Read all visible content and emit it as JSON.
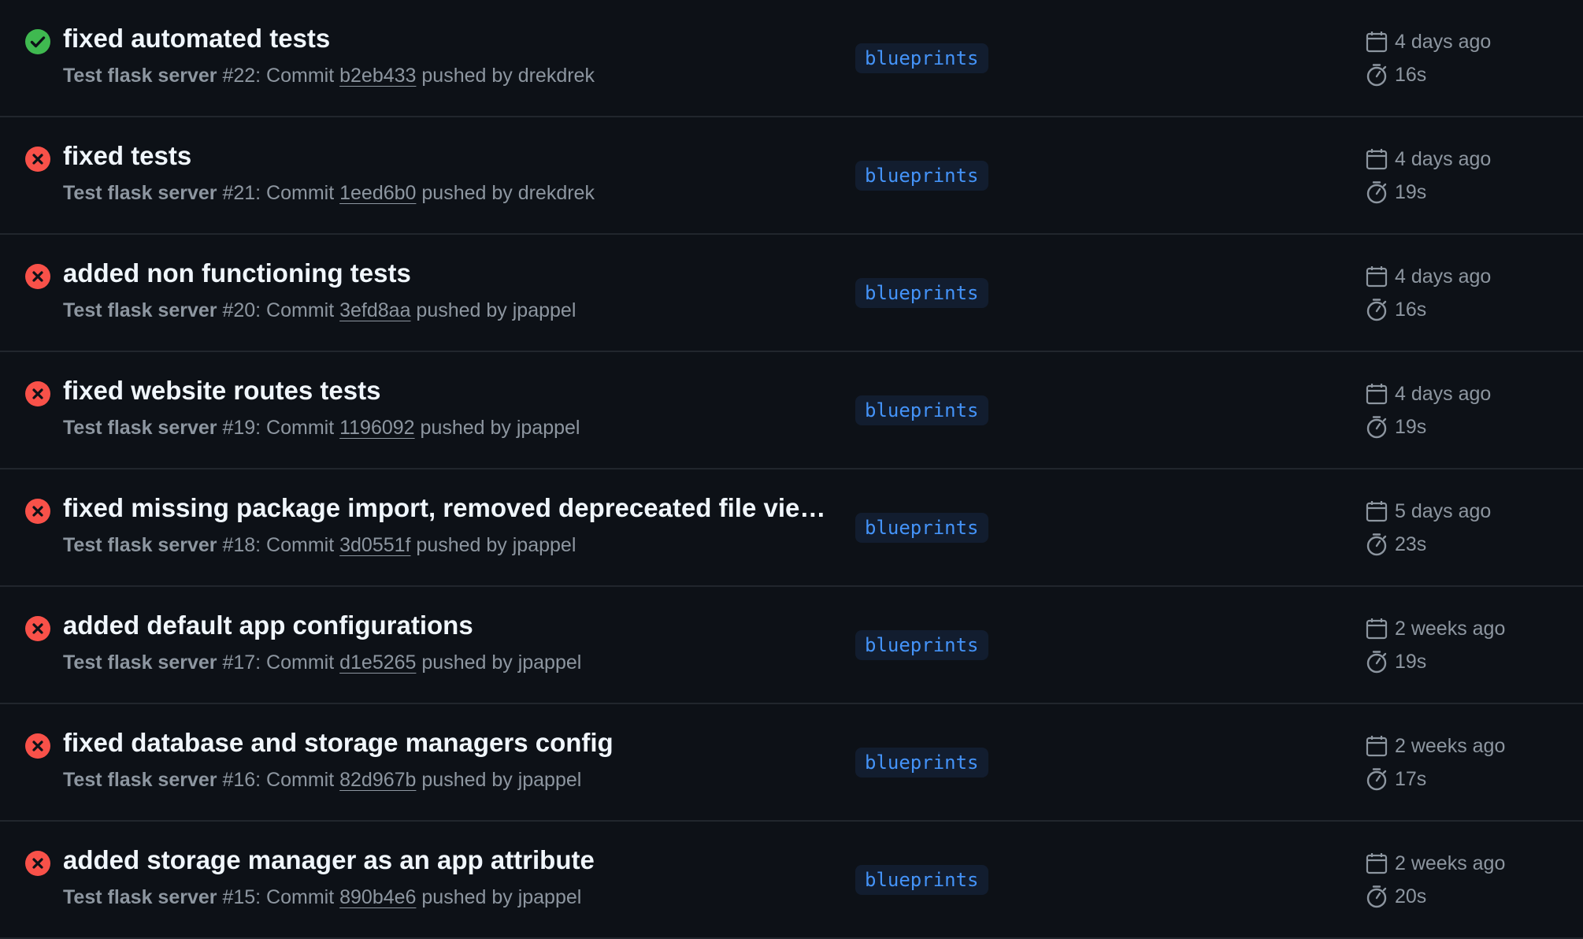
{
  "colors": {
    "success": "#3fb950",
    "failure": "#f85149",
    "branch_text": "#4493f8",
    "branch_bg": "#121d2f",
    "background": "#0d1117"
  },
  "runs": [
    {
      "status": "success",
      "status_icon": "check-circle-icon",
      "title": "fixed automated tests",
      "workflow": "Test flask server",
      "run_number": " #22: Commit ",
      "commit": "b2eb433",
      "pushed_by": " pushed by drekdrek",
      "branch": "blueprints",
      "date": "4 days ago",
      "duration": "16s"
    },
    {
      "status": "failure",
      "status_icon": "x-circle-icon",
      "title": "fixed tests",
      "workflow": "Test flask server",
      "run_number": " #21: Commit ",
      "commit": "1eed6b0",
      "pushed_by": " pushed by drekdrek",
      "branch": "blueprints",
      "date": "4 days ago",
      "duration": "19s"
    },
    {
      "status": "failure",
      "status_icon": "x-circle-icon",
      "title": "added non functioning tests",
      "workflow": "Test flask server",
      "run_number": " #20: Commit ",
      "commit": "3efd8aa",
      "pushed_by": " pushed by jpappel",
      "branch": "blueprints",
      "date": "4 days ago",
      "duration": "16s"
    },
    {
      "status": "failure",
      "status_icon": "x-circle-icon",
      "title": "fixed website routes tests",
      "workflow": "Test flask server",
      "run_number": " #19: Commit ",
      "commit": "1196092",
      "pushed_by": " pushed by jpappel",
      "branch": "blueprints",
      "date": "4 days ago",
      "duration": "19s"
    },
    {
      "status": "failure",
      "status_icon": "x-circle-icon",
      "title": "fixed missing package import, removed depreceated file view ...",
      "workflow": "Test flask server",
      "run_number": " #18: Commit ",
      "commit": "3d0551f",
      "pushed_by": " pushed by jpappel",
      "branch": "blueprints",
      "date": "5 days ago",
      "duration": "23s"
    },
    {
      "status": "failure",
      "status_icon": "x-circle-icon",
      "title": "added default app configurations",
      "workflow": "Test flask server",
      "run_number": " #17: Commit ",
      "commit": "d1e5265",
      "pushed_by": " pushed by jpappel",
      "branch": "blueprints",
      "date": "2 weeks ago",
      "duration": "19s"
    },
    {
      "status": "failure",
      "status_icon": "x-circle-icon",
      "title": "fixed database and storage managers config",
      "workflow": "Test flask server",
      "run_number": " #16: Commit ",
      "commit": "82d967b",
      "pushed_by": " pushed by jpappel",
      "branch": "blueprints",
      "date": "2 weeks ago",
      "duration": "17s"
    },
    {
      "status": "failure",
      "status_icon": "x-circle-icon",
      "title": "added storage manager as an app attribute",
      "workflow": "Test flask server",
      "run_number": " #15: Commit ",
      "commit": "890b4e6",
      "pushed_by": " pushed by jpappel",
      "branch": "blueprints",
      "date": "2 weeks ago",
      "duration": "20s"
    }
  ]
}
